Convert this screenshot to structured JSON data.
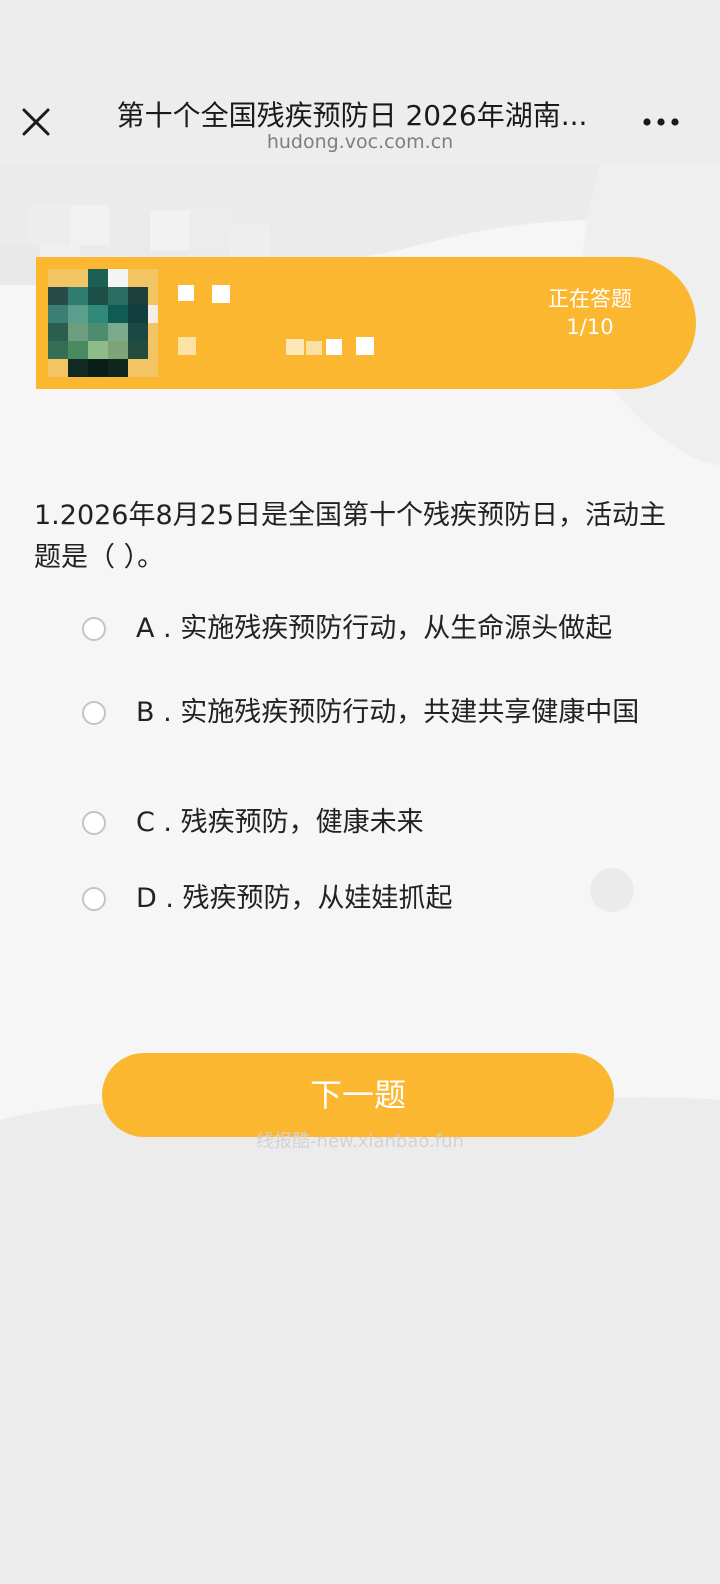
{
  "browser": {
    "title": "第十个全国残疾预防日 2026年湖南...",
    "url": "hudong.voc.com.cn"
  },
  "icons": {
    "close": "close-icon",
    "more": "more-icon",
    "avatar": "avatar-image",
    "radio": "radio-unchecked-icon"
  },
  "banner": {
    "status_label": "正在答题",
    "progress": "1/10",
    "progress_current": 1,
    "progress_total": 10
  },
  "question": {
    "text": "1.2026年8月25日是全国第十个残疾预防日，活动主题是（ ）。"
  },
  "options": [
    {
      "label": "A . 实施残疾预防行动，从生命源头做起",
      "selected": false
    },
    {
      "label": "B . 实施残疾预防行动，共建共享健康中国",
      "selected": false
    },
    {
      "label": "C . 残疾预防，健康未来",
      "selected": false
    },
    {
      "label": "D . 残疾预防，从娃娃抓起",
      "selected": false
    }
  ],
  "next_button": {
    "label": "下一题"
  },
  "watermark": {
    "text": "线报酷-new.xianbao.fun"
  },
  "colors": {
    "accent": "#fcb731",
    "text": "#222222",
    "url": "#7e7e7e",
    "radio_border": "#c4c4c4"
  }
}
